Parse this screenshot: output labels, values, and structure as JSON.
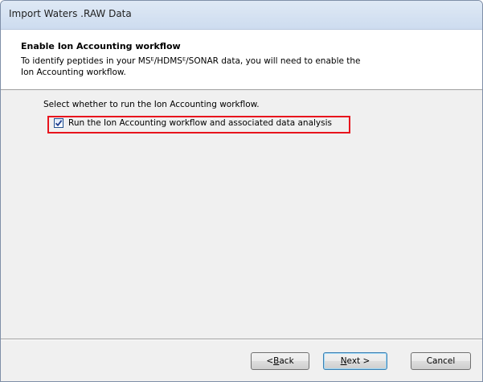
{
  "window": {
    "title": "Import Waters .RAW Data"
  },
  "header": {
    "title": "Enable Ion Accounting workflow",
    "description": "To identify peptides in your MSᴱ/HDMSᴱ/SONAR data, you will need to enable the Ion Accounting workflow."
  },
  "content": {
    "instruction": "Select whether to run the Ion Accounting workflow.",
    "checkbox": {
      "label": "Run the Ion Accounting workflow and associated data analysis",
      "checked": true
    }
  },
  "buttons": {
    "back_prefix": "< ",
    "back_key": "B",
    "back_rest": "ack",
    "next_key": "N",
    "next_rest": "ext >",
    "cancel": "Cancel"
  },
  "colors": {
    "highlight": "#e8141d",
    "checkmark": "#1f3f8f"
  },
  "icons": {
    "checkmark": "checkmark-icon"
  }
}
